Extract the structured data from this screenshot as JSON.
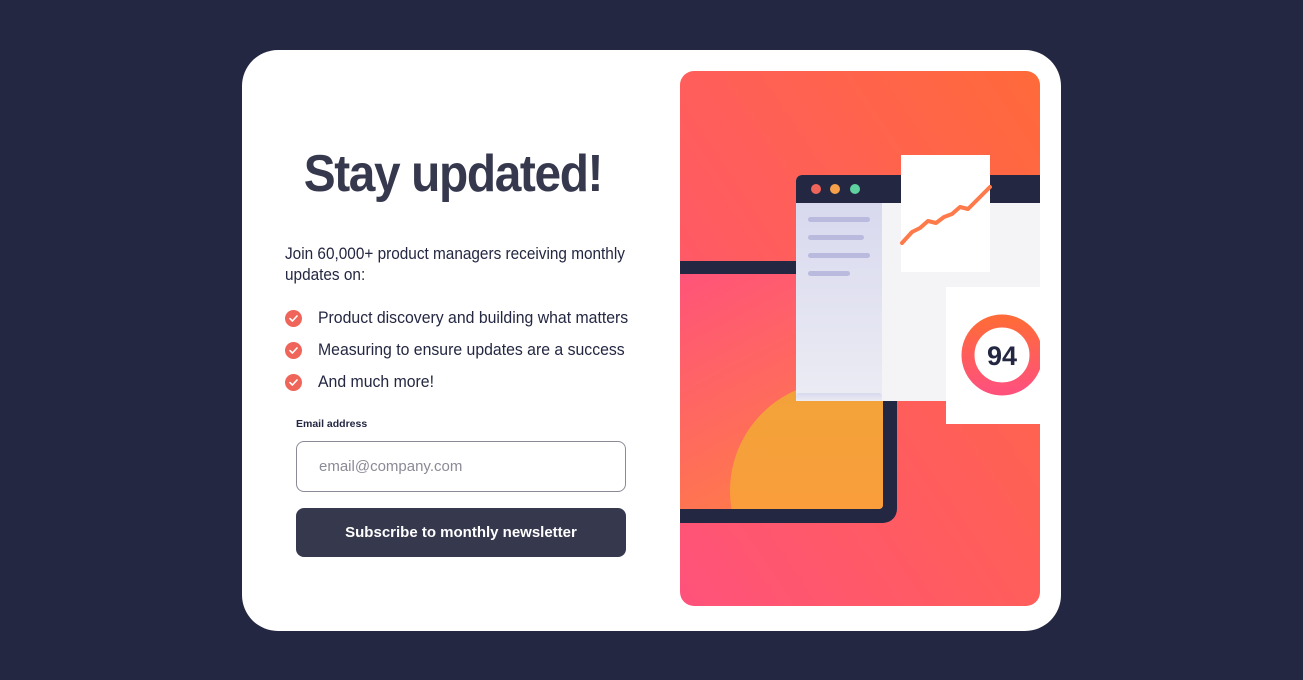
{
  "title": "Stay updated!",
  "intro": "Join 60,000+ product managers receiving monthly updates on:",
  "benefits": [
    "Product discovery and building what matters",
    "Measuring to ensure updates are a success",
    "And much more!"
  ],
  "form": {
    "label": "Email address",
    "placeholder": "email@company.com",
    "submit_label": "Subscribe to monthly newsletter"
  },
  "illustration": {
    "score": "94"
  },
  "icons": {
    "list_bullet": "check-icon"
  },
  "colors": {
    "background": "#242742",
    "card": "#ffffff",
    "title": "#36384e",
    "button": "#36384e",
    "accent": "#f0655a",
    "gradient_start": "#ff6a3a",
    "gradient_end": "#ff527b"
  }
}
